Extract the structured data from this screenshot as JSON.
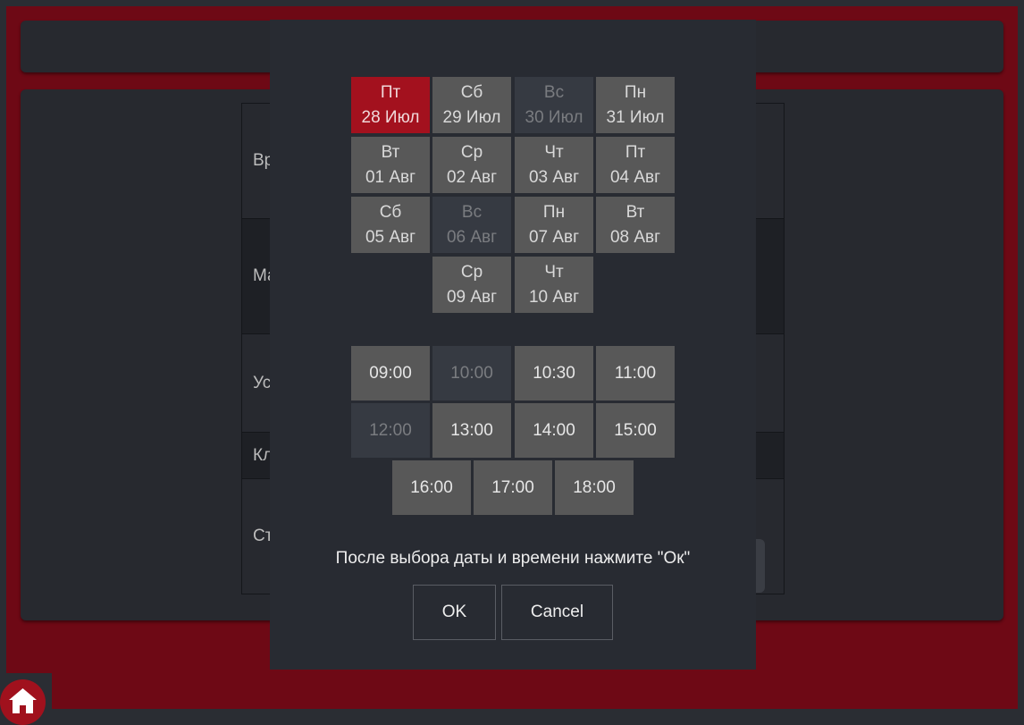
{
  "background": {
    "rows": [
      {
        "label": "Вр"
      },
      {
        "label": "Ма"
      },
      {
        "label": "Ус"
      },
      {
        "label": "Кл"
      },
      {
        "label": "Ст"
      }
    ]
  },
  "home_button": {
    "icon": "home-icon"
  },
  "modal": {
    "dates": [
      {
        "day": "Пт",
        "date": "28 Июл",
        "state": "selected"
      },
      {
        "day": "Сб",
        "date": "29 Июл",
        "state": "available"
      },
      {
        "day": "Вс",
        "date": "30 Июл",
        "state": "disabled"
      },
      {
        "day": "Пн",
        "date": "31 Июл",
        "state": "available"
      },
      {
        "day": "Вт",
        "date": "01 Авг",
        "state": "available"
      },
      {
        "day": "Ср",
        "date": "02 Авг",
        "state": "available"
      },
      {
        "day": "Чт",
        "date": "03 Авг",
        "state": "available"
      },
      {
        "day": "Пт",
        "date": "04 Авг",
        "state": "available"
      },
      {
        "day": "Сб",
        "date": "05 Авг",
        "state": "available"
      },
      {
        "day": "Вс",
        "date": "06 Авг",
        "state": "disabled"
      },
      {
        "day": "Пн",
        "date": "07 Авг",
        "state": "available"
      },
      {
        "day": "Вт",
        "date": "08 Авг",
        "state": "available"
      },
      {
        "day": "Ср",
        "date": "09 Авг",
        "state": "available"
      },
      {
        "day": "Чт",
        "date": "10 Авг",
        "state": "available"
      }
    ],
    "times": [
      {
        "label": "09:00",
        "state": "available"
      },
      {
        "label": "10:00",
        "state": "disabled"
      },
      {
        "label": "10:30",
        "state": "available"
      },
      {
        "label": "11:00",
        "state": "available"
      },
      {
        "label": "12:00",
        "state": "disabled"
      },
      {
        "label": "13:00",
        "state": "available"
      },
      {
        "label": "14:00",
        "state": "available"
      },
      {
        "label": "15:00",
        "state": "available"
      },
      {
        "label": "16:00",
        "state": "available"
      },
      {
        "label": "17:00",
        "state": "available"
      },
      {
        "label": "18:00",
        "state": "available"
      }
    ],
    "hint": "После выбора даты и времени нажмите \"Ок\"",
    "ok_label": "OK",
    "cancel_label": "Cancel"
  },
  "colors": {
    "accent": "#a3111e",
    "frame": "#6e0915",
    "panel": "#27292f",
    "cell": "#585858",
    "cell_disabled": "#363a42"
  }
}
